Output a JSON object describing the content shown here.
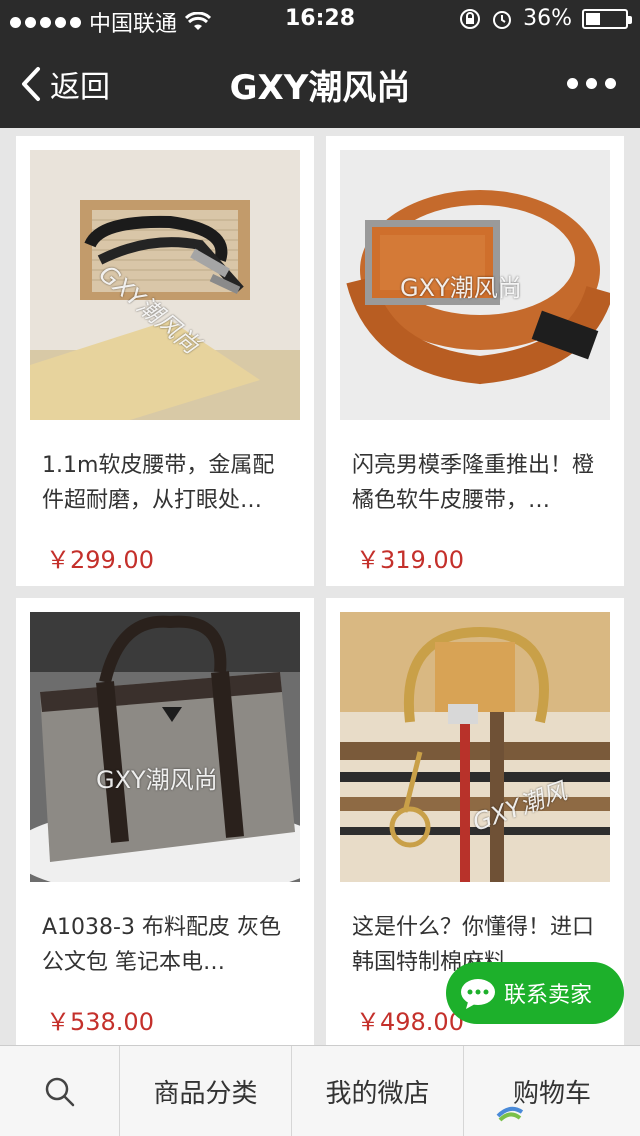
{
  "status_bar": {
    "carrier": "中国联通",
    "time": "16:28",
    "battery": "36%",
    "battery_level": 0.36
  },
  "nav": {
    "back_label": "返回",
    "title": "GXY潮风尚"
  },
  "products": [
    {
      "name": "1.1m软皮腰带，金属配件超耐磨，从打眼处…",
      "price": "￥299.00",
      "watermark": "GXY潮风尚"
    },
    {
      "name": "闪亮男模季隆重推出！橙橘色软牛皮腰带，…",
      "price": "￥319.00",
      "watermark": "GXY潮风尚"
    },
    {
      "name": "A1038-3 布料配皮 灰色 公文包 笔记本电…",
      "price": "￥538.00",
      "watermark": "GXY潮风尚"
    },
    {
      "name": "这是什么？你懂得！进口韩国特制棉麻料…",
      "price": "￥498.00",
      "watermark": "GXY潮风"
    }
  ],
  "chat_button": {
    "label": "联系卖家"
  },
  "bottom_nav": {
    "tabs": [
      "商品分类",
      "我的微店",
      "购物车"
    ]
  },
  "colors": {
    "bar": "#2b2b2b",
    "price": "#c4302b",
    "chat": "#1db02b"
  }
}
